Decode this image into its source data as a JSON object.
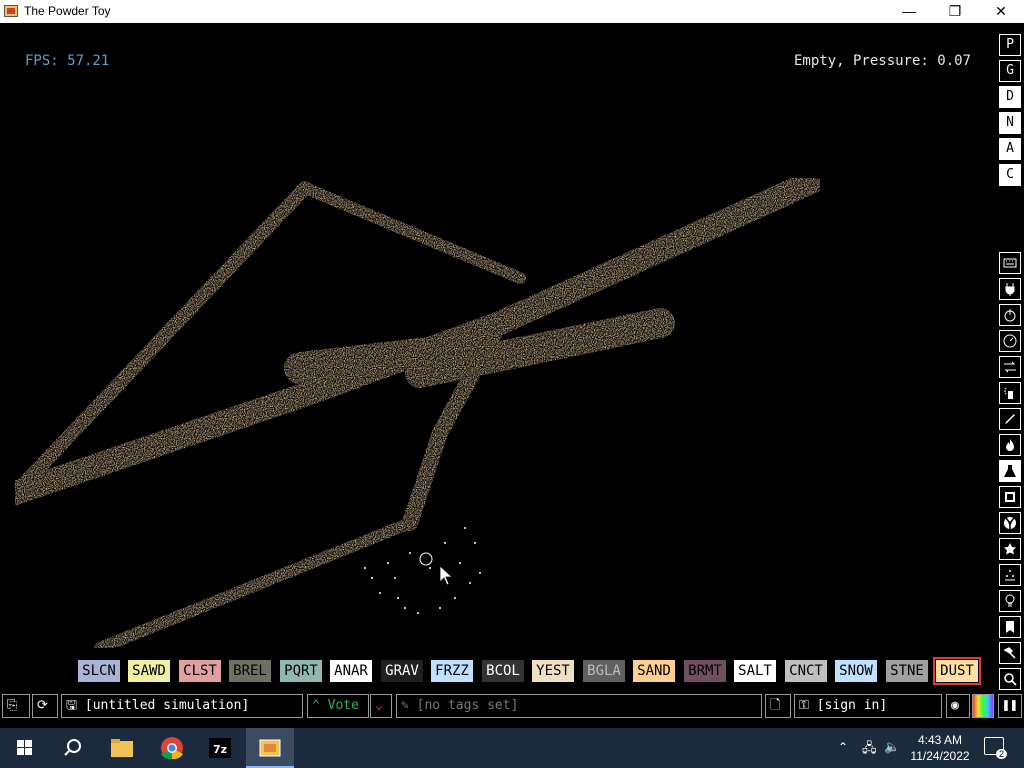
{
  "window": {
    "title": "The Powder Toy",
    "minimize_glyph": "—",
    "maximize_glyph": "❐",
    "close_glyph": "✕"
  },
  "hud": {
    "fps": "FPS: 57.21",
    "status": "Empty, Pressure: 0.07"
  },
  "top_buttons": [
    "P",
    "G",
    "D",
    "N",
    "A",
    "C"
  ],
  "top_buttons_active": [
    "D",
    "N",
    "A",
    "C"
  ],
  "category_icons": [
    "keyboard-icon",
    "plug-icon",
    "power-icon",
    "gauge-icon",
    "arrows-icon",
    "spray-icon",
    "pencil-icon",
    "flame-icon",
    "flask-icon",
    "square-icon",
    "radiation-icon",
    "star-icon",
    "dots-icon",
    "bulb-icon",
    "bookmark-icon",
    "hammer-icon",
    "magnifier-icon"
  ],
  "elements": [
    {
      "label": "SLCN",
      "color": "#a8b5d8"
    },
    {
      "label": "SAWD",
      "color": "#f0f0a0"
    },
    {
      "label": "CLST",
      "color": "#e0a0a0"
    },
    {
      "label": "BREL",
      "color": "#707060"
    },
    {
      "label": "PQRT",
      "color": "#90b8b0"
    },
    {
      "label": "ANAR",
      "color": "#ffffff"
    },
    {
      "label": "GRAV",
      "color": "#202020"
    },
    {
      "label": "FRZZ",
      "color": "#c0e0ff"
    },
    {
      "label": "BCOL",
      "color": "#333333"
    },
    {
      "label": "YEST",
      "color": "#eee0c0"
    },
    {
      "label": "BGLA",
      "color": "#606060"
    },
    {
      "label": "SAND",
      "color": "#ffd090"
    },
    {
      "label": "BRMT",
      "color": "#705060"
    },
    {
      "label": "SALT",
      "color": "#ffffff"
    },
    {
      "label": "CNCT",
      "color": "#c0c0c0"
    },
    {
      "label": "SNOW",
      "color": "#c0e0ff"
    },
    {
      "label": "STNE",
      "color": "#a0a0a0"
    },
    {
      "label": "DUST",
      "color": "#ffe0a0"
    }
  ],
  "selected_element": "DUST",
  "bottom": {
    "sim_name": "[untitled simulation]",
    "vote": "Vote",
    "tags": "[no tags set]",
    "sign_in": "[sign in]"
  },
  "taskbar": {
    "apps": [
      "start-icon",
      "search-icon",
      "file-explorer-icon",
      "chrome-icon",
      "7zip-icon",
      "powder-toy-icon"
    ],
    "sevenzip_label": "7z",
    "time": "4:43 AM",
    "date": "11/24/2022",
    "notifications": "2"
  },
  "colors": {
    "dust": "#f5d6a8",
    "fps": "#5fa0c8",
    "vote": "#2fb34a"
  }
}
